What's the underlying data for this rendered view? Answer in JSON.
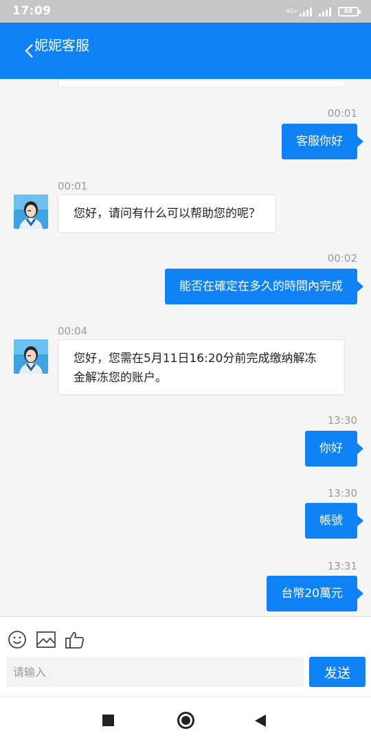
{
  "status_bar": {
    "time": "17:09",
    "network": "4G+",
    "battery": "68"
  },
  "header": {
    "title": "妮妮客服",
    "back_icon": "chevron-left-icon"
  },
  "colors": {
    "accent": "#0f82f5",
    "background": "#f5f5f5"
  },
  "messages": [
    {
      "side": "out",
      "time": "00:01",
      "text": "客服你好"
    },
    {
      "side": "in",
      "time": "00:01",
      "text": "您好，请问有什么可以帮助您的呢？"
    },
    {
      "side": "out",
      "time": "00:02",
      "text": "能否在確定在多久的時間內完成"
    },
    {
      "side": "in",
      "time": "00:04",
      "text_line1": "您好，您需在5月11日16:20分前完成缴纳解冻",
      "text_line2": "金解冻您的账户。"
    },
    {
      "side": "out",
      "time": "13:30",
      "text": "你好"
    },
    {
      "side": "out",
      "time": "13:30",
      "text": "帳號"
    },
    {
      "side": "out",
      "time": "13:31",
      "text": "台幣20萬元"
    }
  ],
  "toolbar": {
    "icons": [
      "emoji-icon",
      "image-icon",
      "thumbs-up-icon"
    ]
  },
  "input": {
    "placeholder": "请输入",
    "value": ""
  },
  "send_button": {
    "label": "发送"
  },
  "nav_bar": {
    "icons": [
      "recents-square-icon",
      "home-circle-icon",
      "back-triangle-icon"
    ]
  }
}
